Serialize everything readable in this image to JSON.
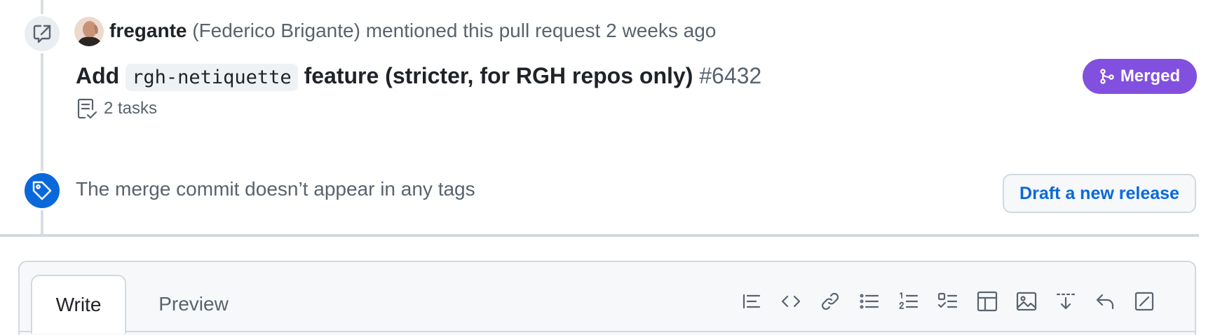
{
  "timeline": {
    "reference_event": {
      "badge_icon": "cross-reference-icon",
      "avatar_icon": "user-avatar",
      "author": "fregante",
      "author_full_name": "(Federico Brigante)",
      "action": "mentioned this pull request",
      "time": "2 weeks ago",
      "pr": {
        "title_prefix": "Add",
        "code": "rgh-netiquette",
        "title_suffix": "feature (stricter, for RGH repos only)",
        "number": "#6432",
        "tasks_icon": "checklist-icon",
        "tasks": "2 tasks",
        "status": "Merged",
        "status_icon": "git-merge-icon",
        "status_color": "#8250df"
      }
    },
    "tag_event": {
      "badge_icon": "tag-icon",
      "badge_color": "#0969da",
      "text": "The merge commit doesn’t appear in any tags",
      "button_label": "Draft a new release"
    }
  },
  "editor": {
    "tabs": [
      "Write",
      "Preview"
    ],
    "active_tab": "Write",
    "toolbar": [
      "heading-icon",
      "code-icon",
      "link-icon",
      "unordered-list-icon",
      "ordered-list-icon",
      "task-list-icon",
      "table-icon",
      "image-icon",
      "fold-down-icon",
      "reply-icon",
      "fullscreen-icon"
    ]
  }
}
